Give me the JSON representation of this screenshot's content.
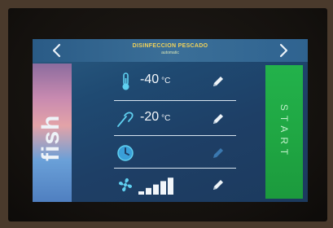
{
  "header": {
    "title": "DISINFECCION PESCADO",
    "subtitle": "automatic"
  },
  "brand": {
    "text": "fish"
  },
  "rows": [
    {
      "name": "temperature",
      "value": "-40",
      "unit": "°C",
      "icon": "thermometer-icon"
    },
    {
      "name": "probe",
      "value": "-20",
      "unit": "°C",
      "icon": "probe-icon"
    },
    {
      "name": "timer",
      "value": "",
      "unit": "",
      "icon": "clock-icon"
    },
    {
      "name": "fan",
      "value": "",
      "unit": "",
      "icon": "fan-icon",
      "level": 5,
      "level_max": 5
    }
  ],
  "start": {
    "label": "START"
  },
  "colors": {
    "start_green": "#1fa542",
    "title_yellow": "#f2d35a",
    "screen_blue": "#1e3f66",
    "icon_cyan": "#5fd0f0"
  }
}
